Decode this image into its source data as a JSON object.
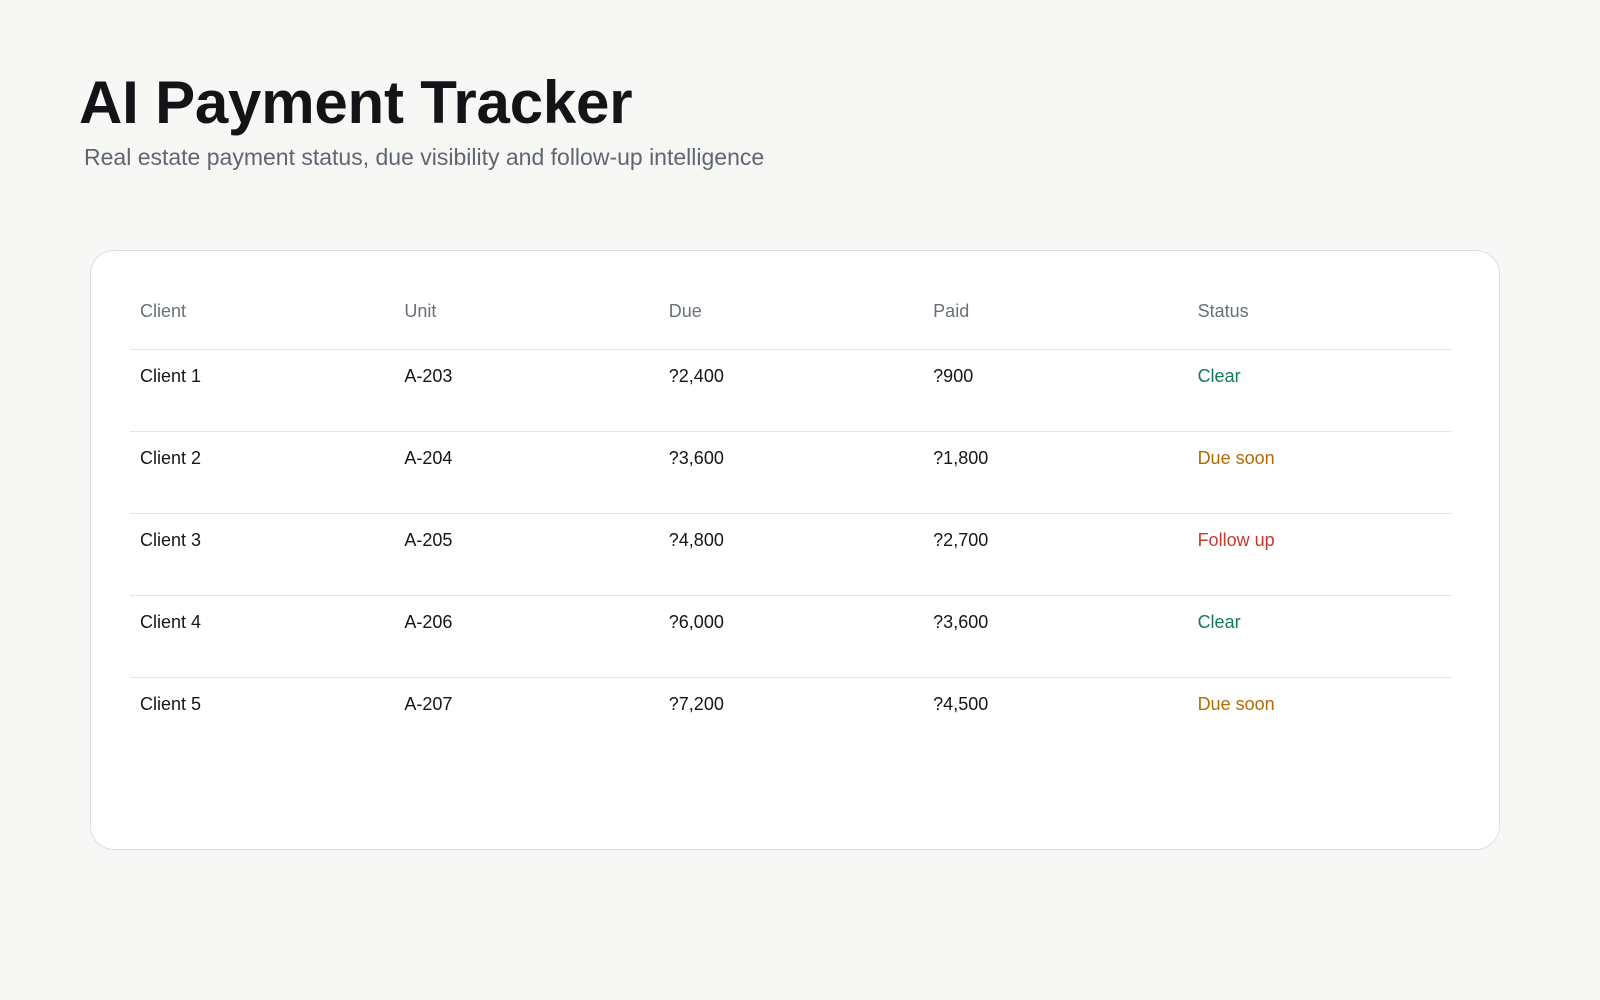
{
  "header": {
    "title": "AI Payment Tracker",
    "subtitle": "Real estate payment status, due visibility and follow-up intelligence"
  },
  "table": {
    "columns": [
      "Client",
      "Unit",
      "Due",
      "Paid",
      "Status"
    ],
    "rows": [
      {
        "client": "Client 1",
        "unit": "A-203",
        "due": "?2,400",
        "paid": "?900",
        "status": "Clear"
      },
      {
        "client": "Client 2",
        "unit": "A-204",
        "due": "?3,600",
        "paid": "?1,800",
        "status": "Due soon"
      },
      {
        "client": "Client 3",
        "unit": "A-205",
        "due": "?4,800",
        "paid": "?2,700",
        "status": "Follow up"
      },
      {
        "client": "Client 4",
        "unit": "A-206",
        "due": "?6,000",
        "paid": "?3,600",
        "status": "Clear"
      },
      {
        "client": "Client 5",
        "unit": "A-207",
        "due": "?7,200",
        "paid": "?4,500",
        "status": "Due soon"
      }
    ]
  },
  "colors": {
    "background": "#f7f8f6",
    "title": "#121417",
    "subtitle": "#5f6670",
    "status_clear": "#137a52",
    "status_due_soon": "#b26b00",
    "status_follow_up": "#c23a30"
  }
}
